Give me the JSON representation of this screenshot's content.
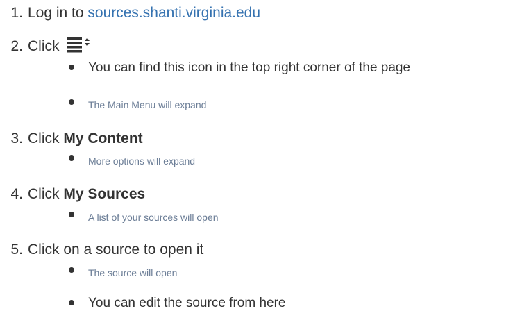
{
  "steps": [
    {
      "num": "1.",
      "prefix": "Log in to ",
      "link": "sources.shanti.virginia.edu"
    },
    {
      "num": "2.",
      "prefix": "Click",
      "icon": "main-menu-icon"
    },
    {
      "num": "3.",
      "prefix": "Click ",
      "bold": "My Content"
    },
    {
      "num": "4.",
      "prefix": "Click ",
      "bold": "My Sources"
    },
    {
      "num": "5.",
      "text": "Click on a source to open it"
    }
  ],
  "subs": [
    "You can find this icon in the top right corner of the page",
    "The Main Menu will expand",
    "More options will expand",
    "A list of your sources will open",
    "The source will open",
    "You can edit the source from here"
  ],
  "colors": {
    "text": "#333333",
    "link": "#3572b0",
    "note": "#6b7d96"
  }
}
